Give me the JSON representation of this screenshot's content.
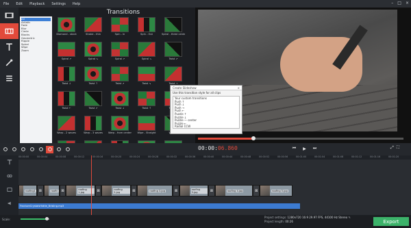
{
  "menu": [
    "File",
    "Edit",
    "Playback",
    "Settings",
    "Help"
  ],
  "window_controls": [
    "–",
    "□",
    "×"
  ],
  "left_tools": [
    {
      "icon": "film-icon",
      "active": false
    },
    {
      "icon": "transitions-icon",
      "active": true
    },
    {
      "icon": "text-icon",
      "active": false
    },
    {
      "icon": "magic-wand-icon",
      "active": false
    },
    {
      "icon": "menu-icon",
      "active": false
    }
  ],
  "categories": [
    "All",
    "Artistic",
    "Fade",
    "Blur",
    "Circle",
    "Blocks",
    "Geometric",
    "Ripple",
    "Spiral",
    "Wipe",
    "Zoom"
  ],
  "transitions_title": "Transitions",
  "transitions": [
    {
      "label": "Diamond - stack",
      "style": "t1",
      "red": false
    },
    {
      "label": "Stroke - thin",
      "style": "t0",
      "red": false
    },
    {
      "label": "Spin - in",
      "style": "t2",
      "red": false
    },
    {
      "label": "Spin - Out",
      "style": "t3",
      "red": false
    },
    {
      "label": "Spiral - three center",
      "style": "t4",
      "red": false
    },
    {
      "label": "Spiral ↗",
      "style": "t5",
      "red": false
    },
    {
      "label": "Spiral ↘",
      "style": "t1",
      "red": false
    },
    {
      "label": "Spiral ↗",
      "style": "t2",
      "red": false
    },
    {
      "label": "Spiral ↘",
      "style": "t0",
      "red": false
    },
    {
      "label": "Twist ↗",
      "style": "t4",
      "red": false
    },
    {
      "label": "Twist ↓",
      "style": "t3",
      "red": false
    },
    {
      "label": "Twist ↑",
      "style": "t1",
      "red": false
    },
    {
      "label": "Twist ↗",
      "style": "t2",
      "red": false
    },
    {
      "label": "Twist ↘",
      "style": "t5",
      "red": false
    },
    {
      "label": "Twist →",
      "style": "t0",
      "red": false
    },
    {
      "label": "Twist ←",
      "style": "t3",
      "red": false
    },
    {
      "label": "Twist ↗",
      "style": "t4",
      "red": false
    },
    {
      "label": "Twist ↓",
      "style": "t1",
      "red": false
    },
    {
      "label": "Twist ↑",
      "style": "t2",
      "red": false
    },
    {
      "label": "Twist ↘",
      "style": "t5",
      "red": false
    },
    {
      "label": "Warp - 2 waves",
      "style": "t0",
      "red": false
    },
    {
      "label": "Warp - 3 waves",
      "style": "t3",
      "red": false
    },
    {
      "label": "Warp - from center",
      "style": "t1",
      "red": false
    },
    {
      "label": "Wipe - Straight",
      "style": "t5",
      "red": false
    },
    {
      "label": "Wipe ↗",
      "style": "t4",
      "red": false
    },
    {
      "label": "Wipe ↘",
      "style": "t2",
      "red": false
    },
    {
      "label": "Wipe ↓",
      "style": "t0",
      "red": false
    },
    {
      "label": "Zoom in",
      "style": "t3",
      "red": false
    },
    {
      "label": "Zoom in cut",
      "style": "t1",
      "red": true
    },
    {
      "label": "Zoom in cut",
      "style": "t5",
      "red": true
    }
  ],
  "dialog": {
    "title": "Create Slideshow",
    "option": "Use this transition style for all clips",
    "list_header": "Your custom transitions",
    "items": [
      "Push ↑",
      "Push ↓",
      "Push →",
      "Push ←",
      "Puzzle ↑",
      "Puzzle ↓",
      "Puzzle — center",
      "Puzzle ←",
      "Radial CCW"
    ]
  },
  "edit_tools": [
    "cut-icon",
    "rotate-icon",
    "crop-icon",
    "contrast-icon",
    "delete-icon",
    "record-icon",
    "mic-icon",
    "settings-icon"
  ],
  "timecode": {
    "main": "00:00:",
    "fraction": "06.860"
  },
  "playback": [
    "⏮",
    "▶",
    "⏭"
  ],
  "fullscreen": [
    "⤢",
    "⛶"
  ],
  "ruler_ticks": [
    "00:00:00",
    "00:00:04",
    "00:00:08",
    "00:00:12",
    "00:00:16",
    "00:00:20",
    "00:00:24",
    "00:00:28",
    "00:00:32",
    "00:00:36",
    "00:00:40",
    "00:00:44",
    "00:00:48",
    "00:00:52",
    "00:00:56",
    "00:01:00",
    "00:01:04",
    "00:01:08",
    "00:01:12",
    "00:01:16",
    "00:01:20"
  ],
  "clips": [
    {
      "name": "roofing1",
      "kind": "photo"
    },
    {
      "name": "roofin",
      "kind": "photo"
    },
    {
      "name": "roofing 1.jpg",
      "kind": "photo"
    },
    {
      "name": "roofing 2.jpg",
      "kind": "photo"
    },
    {
      "name": "roofing 3.jpg",
      "kind": "photo"
    },
    {
      "name": "roofing 3.jpg",
      "kind": "photo"
    },
    {
      "name": "roofing 4.jpg",
      "kind": "photo"
    },
    {
      "name": "roofing 5.jpg",
      "kind": "photo"
    }
  ],
  "audio_track": "FractureCrystalsHidtle_Brisling.mp3",
  "status": {
    "scale_label": "Scale:",
    "scale_value": 0.9,
    "project_settings_label": "Project settings:",
    "project_settings_value": "1280x720 16:9 29.97 FPS, 44100 Hz Stereo",
    "project_length_label": "Project length:",
    "project_length_value": "00:26",
    "export_label": "Export"
  }
}
